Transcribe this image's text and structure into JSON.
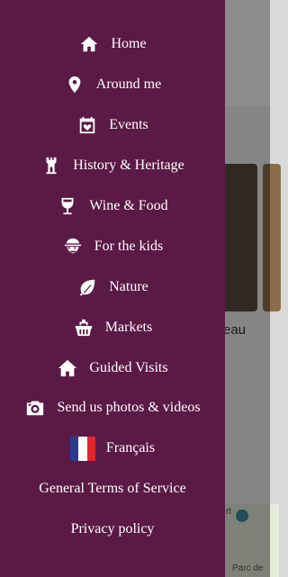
{
  "drawer": {
    "background": "#5b1a45",
    "items": [
      {
        "label": "Home",
        "icon": "home-icon"
      },
      {
        "label": "Around me",
        "icon": "location-pin-icon"
      },
      {
        "label": "Events",
        "icon": "calendar-heart-icon"
      },
      {
        "label": "History & Heritage",
        "icon": "tower-icon"
      },
      {
        "label": "Wine & Food",
        "icon": "wine-glass-icon"
      },
      {
        "label": "For the kids",
        "icon": "kid-face-icon"
      },
      {
        "label": "Nature",
        "icon": "leaf-icon"
      },
      {
        "label": "Markets",
        "icon": "basket-icon"
      },
      {
        "label": "Guided Visits",
        "icon": "house-icon"
      },
      {
        "label": "Send us photos & videos",
        "icon": "camera-icon"
      },
      {
        "label": "Français",
        "icon": "french-flag-icon"
      }
    ],
    "links": [
      {
        "label": "General Terms of Service"
      },
      {
        "label": "Privacy policy"
      }
    ]
  },
  "background": {
    "caption": "eau",
    "map_label_1": "rt",
    "map_label_2": "Parc de"
  }
}
